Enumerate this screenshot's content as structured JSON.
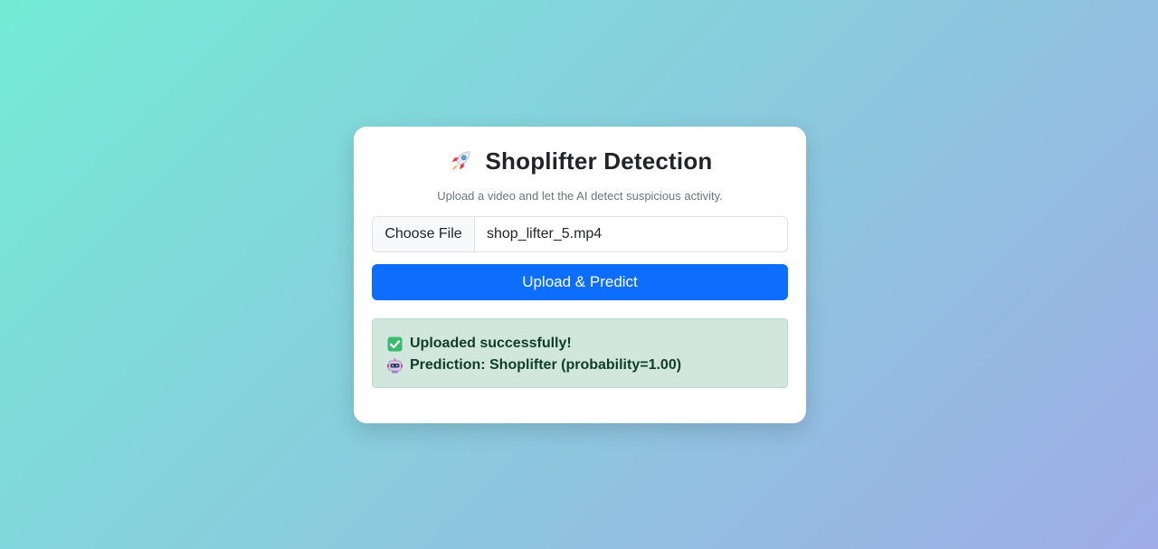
{
  "header": {
    "title": "Shoplifter Detection",
    "icon": "rocket-icon",
    "subtitle": "Upload a video and let the AI detect suspicious activity."
  },
  "file_input": {
    "button_label": "Choose File",
    "file_name": "shop_lifter_5.mp4"
  },
  "upload_button": {
    "label": "Upload & Predict"
  },
  "result": {
    "status_icon": "check-box-icon",
    "status_text": "Uploaded successfully!",
    "prediction_icon": "robot-icon",
    "prediction_text": "Prediction: Shoplifter (probability=1.00)"
  },
  "colors": {
    "primary": "#0d6efd",
    "success_bg": "#d1e7dd",
    "success_text": "#0f3d2a",
    "bg_gradient_start": "#74ebd5",
    "bg_gradient_end": "#9face6"
  }
}
